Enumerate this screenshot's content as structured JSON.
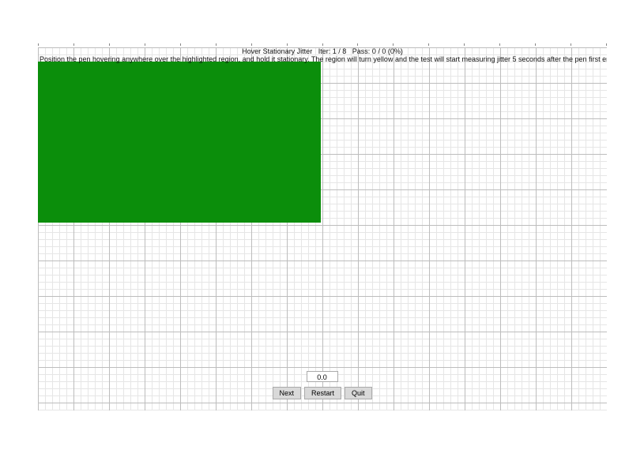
{
  "header": {
    "title_prefix": "Hover Stationary Jitter",
    "iter_label": "Iter:",
    "iter_value": "1 / 8",
    "pass_label": "Pass:",
    "pass_value": "0 / 0 (0%)",
    "instructions": "Position the pen hovering anywhere over the highlighted region, and hold it stationary. The region will turn yellow and the test will start measuring jitter 5 seconds after the pen first enters hover range. Once the region turns green again, lift the pen."
  },
  "highlight": {
    "color": "#0b8e0b"
  },
  "readout": {
    "value": "0.0"
  },
  "buttons": {
    "next": "Next",
    "restart": "Restart",
    "quit": "Quit"
  }
}
